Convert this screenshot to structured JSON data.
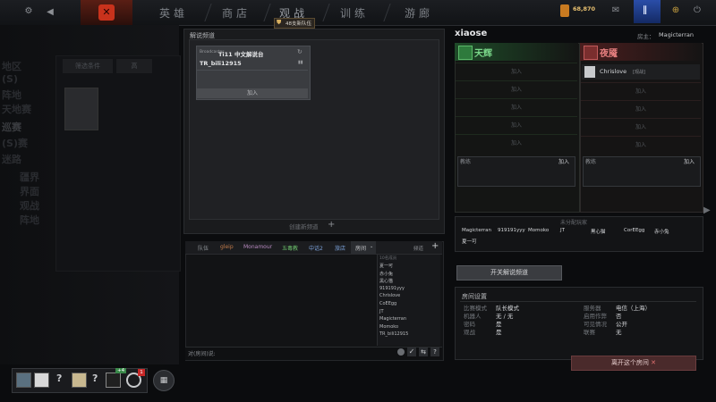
{
  "nav": {
    "tabs": [
      "英雄",
      "商店",
      "观战",
      "训练",
      "游廊"
    ],
    "party_badge": "48支新队伍",
    "currency": "68,870"
  },
  "left_ghost": {
    "items": [
      "地区",
      "(S)",
      "阵地",
      "天地赛",
      "巡赛",
      "(S)赛",
      "迷路",
      "疆界",
      "界面",
      "观战",
      "阵地"
    ],
    "card_tabs": [
      "筛选条件",
      "高"
    ]
  },
  "broadcast": {
    "title": "解说频道",
    "channel": {
      "tag": "Broadcaster",
      "name": "Ti11 中文解说台",
      "member": "TR_bili12915",
      "join_label": "加入"
    },
    "create_label": "创建新频道"
  },
  "chat": {
    "tabs": [
      "队伍",
      "gleip",
      "Monamour",
      "五毒教",
      "中话2",
      "旅店",
      "房间"
    ],
    "tab_colors": [
      "#8c9095",
      "#c07a4a",
      "#b88ac0",
      "#6cc06c",
      "#7aa0d8",
      "#7aa0d8",
      "#c8cacd"
    ],
    "active_tab_index": 6,
    "filter_label": "频道",
    "users_header": "10名成员",
    "users": [
      "夏一可",
      "赤小兔",
      "黑心猫",
      "919191yyy",
      "Chrislove",
      "CoEEgg",
      "JT",
      "Magicterran",
      "Momoko",
      "TR_bili12915"
    ],
    "input_placeholder": "对(房间)说:"
  },
  "lobby": {
    "title": "xiaose",
    "host_label": "房主：",
    "host_name": "Magicterran",
    "radiant": {
      "name": "天辉",
      "slots": [
        "加入",
        "加入",
        "加入",
        "加入",
        "加入"
      ],
      "coach_label": "教练",
      "coach_join": "加入"
    },
    "dire": {
      "name": "夜魇",
      "player": "Chrislove",
      "player_suffix": "[观战]",
      "slots": [
        "加入",
        "加入",
        "加入",
        "加入"
      ],
      "coach_label": "教练",
      "coach_join": "加入"
    },
    "unassigned_title": "未分配玩家",
    "unassigned": [
      "Magicterran",
      "919191yyy",
      "Momoko",
      "JT",
      "黑心猫",
      "CorEEgg",
      "赤小兔",
      "夏一可"
    ],
    "toggle_broadcast_label": "开关解说频道",
    "settings_title": "房间设置",
    "settings_left": [
      {
        "k": "比赛模式",
        "v": "队长模式"
      },
      {
        "k": "机器人",
        "v": "无 / 无"
      },
      {
        "k": "密码",
        "v": "是"
      },
      {
        "k": "观战",
        "v": "是"
      }
    ],
    "settings_right": [
      {
        "k": "服务器",
        "v": "电信（上海）"
      },
      {
        "k": "启用作弊",
        "v": "否"
      },
      {
        "k": "可见情况",
        "v": "公开"
      },
      {
        "k": "联赛",
        "v": "无"
      }
    ],
    "leave_label": "离开这个房间"
  },
  "party": {
    "badge_count": "+4",
    "notif_count": "1"
  }
}
